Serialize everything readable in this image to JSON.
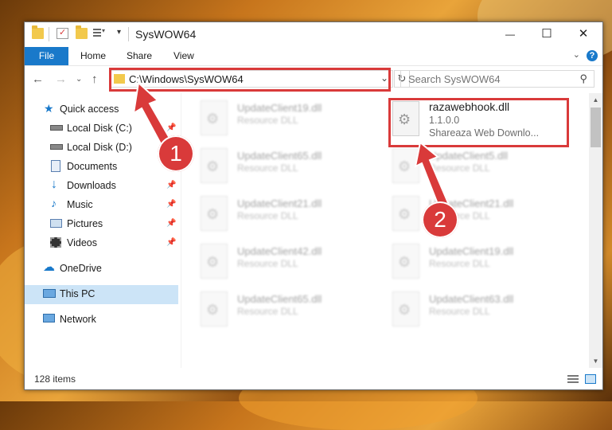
{
  "window": {
    "title": "SysWOW64",
    "minimize": "—",
    "maximize": "☐",
    "close": "✕"
  },
  "ribbon": {
    "tabs": [
      "File",
      "Home",
      "Share",
      "View"
    ],
    "help": "?"
  },
  "navbar": {
    "address_path": "C:\\Windows\\SysWOW64",
    "search_placeholder": "Search SysWOW64"
  },
  "sidebar": {
    "items": [
      {
        "label": "Quick access",
        "icon": "star-icon",
        "pinned": false
      },
      {
        "label": "Local Disk (C:)",
        "icon": "drive-icon",
        "pinned": true
      },
      {
        "label": "Local Disk (D:)",
        "icon": "drive-icon",
        "pinned": true
      },
      {
        "label": "Documents",
        "icon": "documents-icon",
        "pinned": true
      },
      {
        "label": "Downloads",
        "icon": "download-icon",
        "pinned": true
      },
      {
        "label": "Music",
        "icon": "music-icon",
        "pinned": true
      },
      {
        "label": "Pictures",
        "icon": "pictures-icon",
        "pinned": true
      },
      {
        "label": "Videos",
        "icon": "videos-icon",
        "pinned": true
      },
      {
        "label": "OneDrive",
        "icon": "cloud-icon",
        "pinned": false
      },
      {
        "label": "This PC",
        "icon": "computer-icon",
        "pinned": false
      },
      {
        "label": "Network",
        "icon": "network-icon",
        "pinned": false
      }
    ]
  },
  "files": {
    "highlighted": {
      "name": "razawebhook.dll",
      "version": "1.1.0.0",
      "description": "Shareaza Web Downlo..."
    },
    "left_column": [
      {
        "name": "UpdateClient19.dll",
        "type": "Resource DLL"
      },
      {
        "name": "UpdateClient65.dll",
        "type": "Resource DLL"
      },
      {
        "name": "UpdateClient21.dll",
        "type": "Resource DLL"
      },
      {
        "name": "UpdateClient42.dll",
        "type": "Resource DLL"
      },
      {
        "name": "UpdateClient65.dll",
        "type": "Resource DLL"
      }
    ],
    "right_column": [
      {
        "name": "UpdateClient5.dll",
        "type": "Resource DLL"
      },
      {
        "name": "UpdateClient21.dll",
        "type": "Resource DLL"
      },
      {
        "name": "UpdateClient19.dll",
        "type": "Resource DLL"
      },
      {
        "name": "UpdateClient63.dll",
        "type": "Resource DLL"
      }
    ]
  },
  "status": {
    "item_count": "128 items"
  },
  "callouts": {
    "one": "1",
    "two": "2"
  },
  "colors": {
    "accent": "#1979ca",
    "highlight": "#d93a3a",
    "selection": "#cce4f7"
  }
}
